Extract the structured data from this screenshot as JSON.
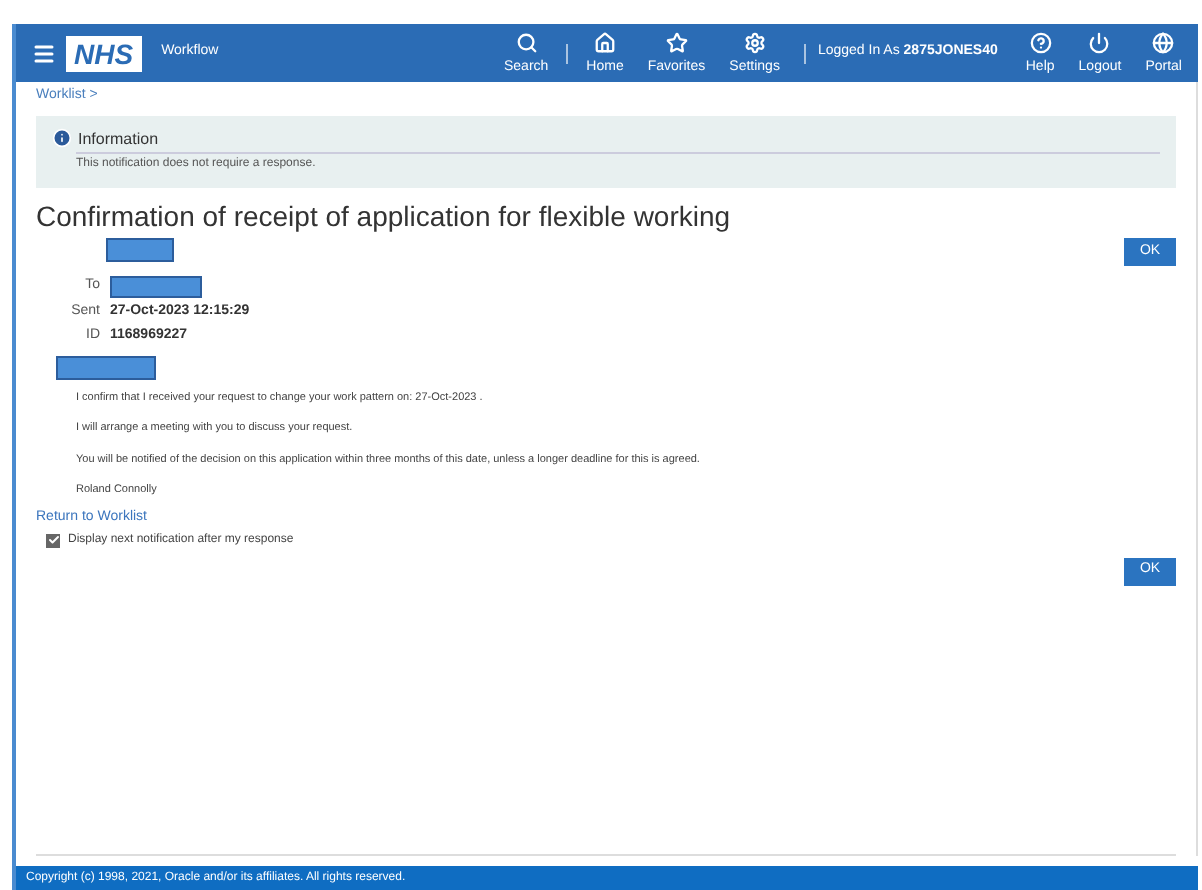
{
  "header": {
    "logo": "NHS",
    "app_name": "Workflow",
    "nav": [
      {
        "kind": "search",
        "label": "Search"
      },
      {
        "kind": "home",
        "label": "Home"
      },
      {
        "kind": "star",
        "label": "Favorites"
      },
      {
        "kind": "gear",
        "label": "Settings"
      }
    ],
    "logged_in_label": "Logged In As",
    "user": "2875JONES40",
    "actions": [
      {
        "kind": "help",
        "label": "Help"
      },
      {
        "kind": "power",
        "label": "Logout"
      },
      {
        "kind": "globe",
        "label": "Portal"
      }
    ]
  },
  "breadcrumb": "Worklist >",
  "info": {
    "title": "Information",
    "message": "This notification does not require a response."
  },
  "title": "Confirmation of receipt of application for flexible working",
  "ok_button": "OK",
  "fields": [
    {
      "label": "To"
    },
    {
      "label": "Sent",
      "value": "27-Oct-2023 12:15:29"
    },
    {
      "label": "ID",
      "value": "1168969227"
    }
  ],
  "paragraphs": [
    "I confirm that I received your request to change your work pattern on: 27-Oct-2023 .",
    "I will arrange a meeting with you to discuss your request.",
    "You will be notified of the decision on this application within three months of this date, unless a longer deadline for this is agreed.",
    "Roland Connolly"
  ],
  "return_link": "Return to Worklist",
  "display_next": {
    "label": "Display next notification after my response",
    "checked": true
  },
  "ok_button_bottom": "OK",
  "footer": "Copyright (c) 1998, 2021, Oracle and/or its affiliates. All rights reserved."
}
